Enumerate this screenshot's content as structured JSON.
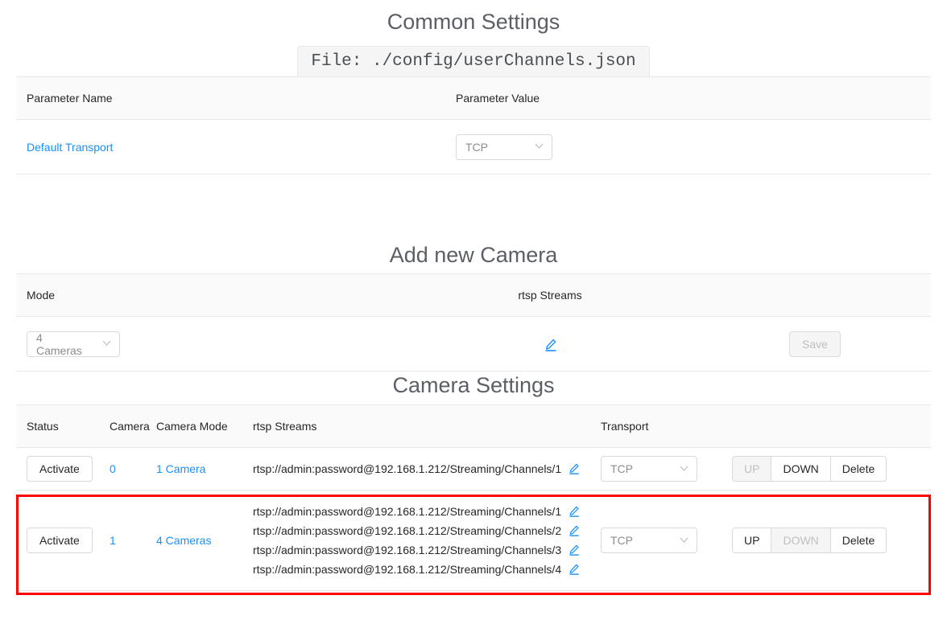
{
  "common_settings": {
    "title": "Common Settings",
    "file_chip": "File: ./config/userChannels.json",
    "columns": [
      "Parameter Name",
      "Parameter Value"
    ],
    "rows": [
      {
        "name": "Default Transport",
        "value": "TCP"
      }
    ]
  },
  "add_new_camera": {
    "title": "Add new Camera",
    "columns": [
      "Mode",
      "rtsp Streams",
      ""
    ],
    "mode_value": "4 Cameras",
    "edit_icon": "pencil-icon",
    "save_label": "Save",
    "save_disabled": true
  },
  "camera_settings": {
    "title": "Camera Settings",
    "columns": [
      "Status",
      "Camera",
      "Camera Mode",
      "rtsp Streams",
      "Transport",
      ""
    ],
    "rows": [
      {
        "status_label": "Activate",
        "camera": "0",
        "camera_mode": "1 Camera",
        "streams": [
          "rtsp://admin:password@192.168.1.212/Streaming/Channels/1"
        ],
        "transport": "TCP",
        "up_label": "UP",
        "up_disabled": true,
        "down_label": "DOWN",
        "down_disabled": false,
        "delete_label": "Delete",
        "highlighted": false
      },
      {
        "status_label": "Activate",
        "camera": "1",
        "camera_mode": "4 Cameras",
        "streams": [
          "rtsp://admin:password@192.168.1.212/Streaming/Channels/1",
          "rtsp://admin:password@192.168.1.212/Streaming/Channels/2",
          "rtsp://admin:password@192.168.1.212/Streaming/Channels/3",
          "rtsp://admin:password@192.168.1.212/Streaming/Channels/4"
        ],
        "transport": "TCP",
        "up_label": "UP",
        "up_disabled": false,
        "down_label": "DOWN",
        "down_disabled": true,
        "delete_label": "Delete",
        "highlighted": true
      }
    ]
  },
  "colors": {
    "link": "#1890ff",
    "highlight_border": "#ff0000",
    "header_bg": "#fafafa",
    "border": "#e8e8e8",
    "title_text": "#5c6066",
    "disabled_text": "#bfbfbf"
  }
}
